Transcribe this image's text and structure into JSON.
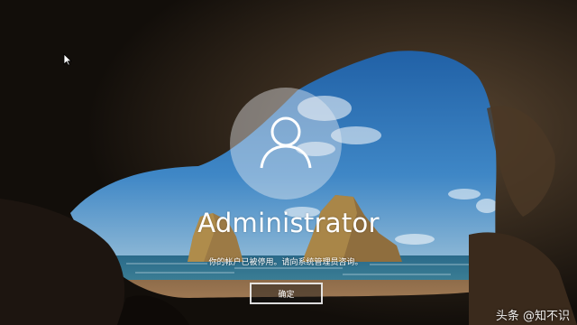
{
  "account": {
    "username": "Administrator",
    "avatar_icon": "user-silhouette-icon"
  },
  "message": {
    "text": "你的帐户已被停用。请向系统管理员咨询。"
  },
  "actions": {
    "ok_label": "确定"
  },
  "pointer": {
    "icon": "mouse-cursor-icon"
  },
  "watermark": {
    "text": "头条 @知不识"
  },
  "colors": {
    "sky": "#2f74b5",
    "sea": "#1d4f6e",
    "sand": "#a57b55",
    "cave": "#1a140f"
  }
}
